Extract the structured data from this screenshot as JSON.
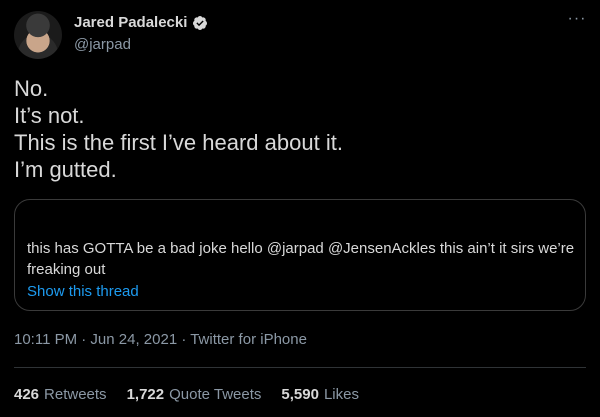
{
  "author": {
    "display_name": "Jared Padalecki",
    "handle": "@jarpad",
    "avatar_icon": "avatar",
    "verified_icon": "verified-badge-icon"
  },
  "menu": {
    "more_label": "···"
  },
  "tweet": {
    "lines": [
      "No.",
      "It’s not.",
      "This is the first I’ve heard about it.",
      "I’m gutted."
    ]
  },
  "quote": {
    "text": "this has GOTTA be a bad joke hello @jarpad @JensenAckles this ain’t it sirs we’re freaking out",
    "show_thread": "Show this thread"
  },
  "meta": {
    "line": "10:11 PM · Jun 24, 2021 · Twitter for iPhone"
  },
  "stats": {
    "retweets": {
      "count": "426",
      "label": "Retweets"
    },
    "quote_tweets": {
      "count": "1,722",
      "label": "Quote Tweets"
    },
    "likes": {
      "count": "5,590",
      "label": "Likes"
    }
  },
  "colors": {
    "link": "#1d9bf0",
    "muted": "#8b98a5",
    "text": "#d9d9d9",
    "background": "#000000"
  }
}
